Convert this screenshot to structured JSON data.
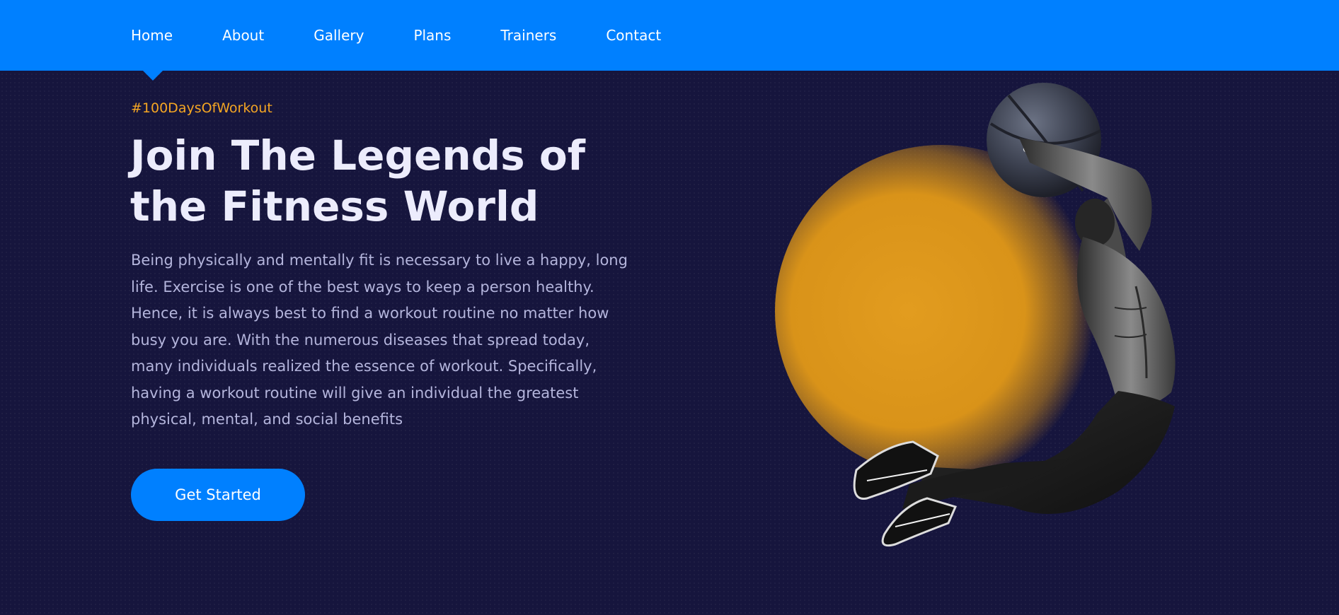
{
  "nav": {
    "items": [
      {
        "label": "Home",
        "active": true
      },
      {
        "label": "About"
      },
      {
        "label": "Gallery"
      },
      {
        "label": "Plans"
      },
      {
        "label": "Trainers"
      },
      {
        "label": "Contact"
      }
    ]
  },
  "hero": {
    "tagline": "#100DaysOfWorkout",
    "title": "Join The Legends of the Fitness World",
    "body": "Being physically and mentally fit is necessary to live a happy, long life. Exercise is one of the best ways to keep a person healthy. Hence, it is always best to find a workout routine no matter how busy you are. With the numerous diseases that spread today, many individuals realized the essence of workout. Specifically, having a workout routine will give an individual the greatest physical, mental, and social benefits",
    "cta_label": "Get Started"
  },
  "colors": {
    "nav_bg": "#0080ff",
    "page_bg": "#16153d",
    "accent": "#f5a623",
    "title": "#ececfc",
    "body_text": "#b4b5dc",
    "glow": "#e29c1f"
  },
  "imagery": {
    "hero_icon": "athlete-with-medicine-ball-icon"
  }
}
